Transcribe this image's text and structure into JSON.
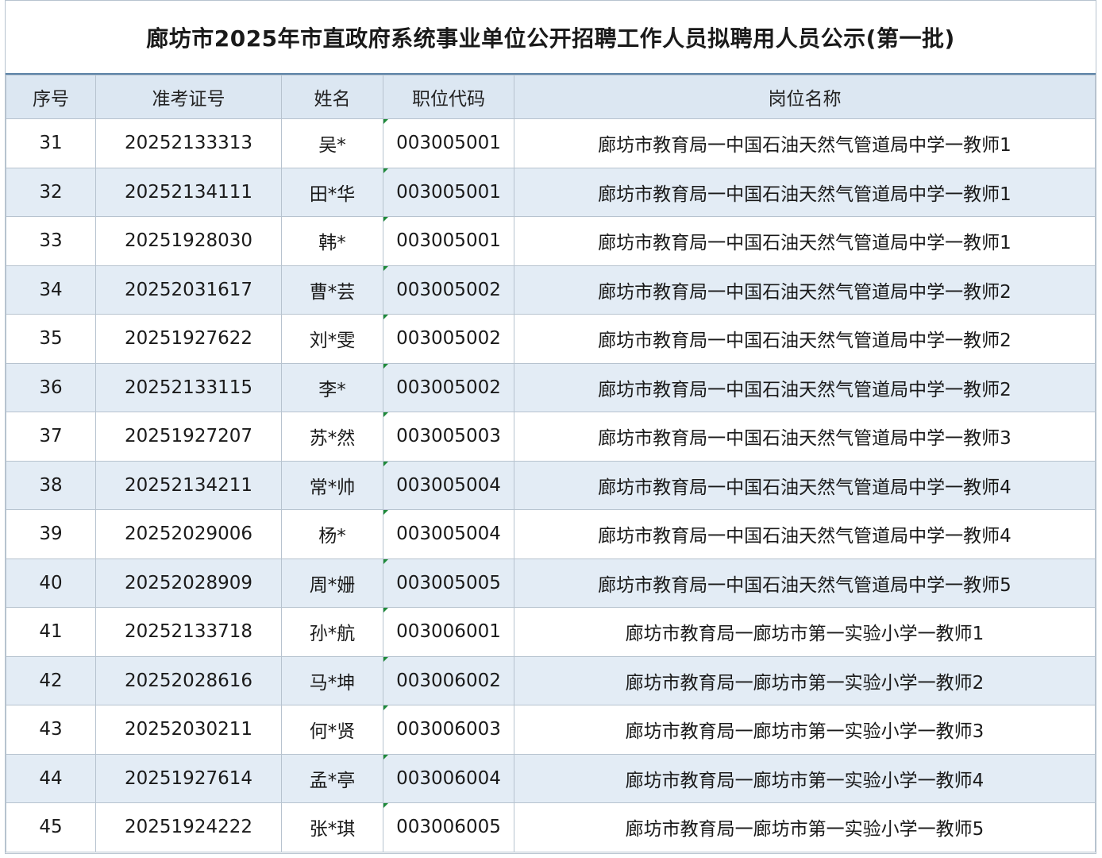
{
  "title": "廊坊市2025年市直政府系统事业单位公开招聘工作人员拟聘用人员公示(第一批)",
  "columns": [
    "序号",
    "准考证号",
    "姓名",
    "职位代码",
    "岗位名称"
  ],
  "rows": [
    {
      "no": "31",
      "exam_id": "20252133313",
      "name": "吴*",
      "code": "003005001",
      "position": "廊坊市教育局一中国石油天然气管道局中学一教师1"
    },
    {
      "no": "32",
      "exam_id": "20252134111",
      "name": "田*华",
      "code": "003005001",
      "position": "廊坊市教育局一中国石油天然气管道局中学一教师1"
    },
    {
      "no": "33",
      "exam_id": "20251928030",
      "name": "韩*",
      "code": "003005001",
      "position": "廊坊市教育局一中国石油天然气管道局中学一教师1"
    },
    {
      "no": "34",
      "exam_id": "20252031617",
      "name": "曹*芸",
      "code": "003005002",
      "position": "廊坊市教育局一中国石油天然气管道局中学一教师2"
    },
    {
      "no": "35",
      "exam_id": "20251927622",
      "name": "刘*雯",
      "code": "003005002",
      "position": "廊坊市教育局一中国石油天然气管道局中学一教师2"
    },
    {
      "no": "36",
      "exam_id": "20252133115",
      "name": "李*",
      "code": "003005002",
      "position": "廊坊市教育局一中国石油天然气管道局中学一教师2"
    },
    {
      "no": "37",
      "exam_id": "20251927207",
      "name": "苏*然",
      "code": "003005003",
      "position": "廊坊市教育局一中国石油天然气管道局中学一教师3"
    },
    {
      "no": "38",
      "exam_id": "20252134211",
      "name": "常*帅",
      "code": "003005004",
      "position": "廊坊市教育局一中国石油天然气管道局中学一教师4"
    },
    {
      "no": "39",
      "exam_id": "20252029006",
      "name": "杨*",
      "code": "003005004",
      "position": "廊坊市教育局一中国石油天然气管道局中学一教师4"
    },
    {
      "no": "40",
      "exam_id": "20252028909",
      "name": "周*姗",
      "code": "003005005",
      "position": "廊坊市教育局一中国石油天然气管道局中学一教师5"
    },
    {
      "no": "41",
      "exam_id": "20252133718",
      "name": "孙*航",
      "code": "003006001",
      "position": "廊坊市教育局一廊坊市第一实验小学一教师1"
    },
    {
      "no": "42",
      "exam_id": "20252028616",
      "name": "马*坤",
      "code": "003006002",
      "position": "廊坊市教育局一廊坊市第一实验小学一教师2"
    },
    {
      "no": "43",
      "exam_id": "20252030211",
      "name": "何*贤",
      "code": "003006003",
      "position": "廊坊市教育局一廊坊市第一实验小学一教师3"
    },
    {
      "no": "44",
      "exam_id": "20251927614",
      "name": "孟*亭",
      "code": "003006004",
      "position": "廊坊市教育局一廊坊市第一实验小学一教师4"
    },
    {
      "no": "45",
      "exam_id": "20251924222",
      "name": "张*琪",
      "code": "003006005",
      "position": "廊坊市教育局一廊坊市第一实验小学一教师5"
    }
  ],
  "colors": {
    "header_bg": "#dce7f2",
    "alt_row_bg": "#e3ecf5",
    "border": "#b7c3cf",
    "title_rule": "#5b82a6",
    "cell_marker": "#1f8a3a"
  }
}
